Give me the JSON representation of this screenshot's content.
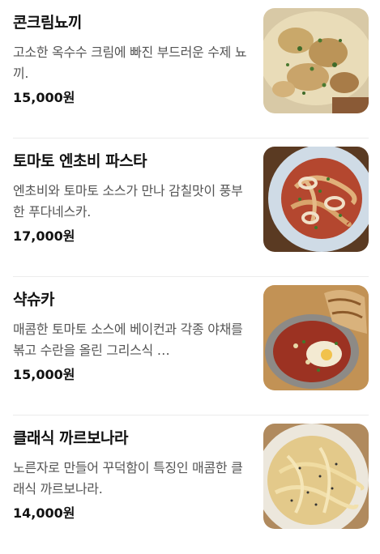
{
  "menu": [
    {
      "name": "콘크림뇨끼",
      "description": "고소한 옥수수 크림에 빠진 부드러운 수제 뇨끼.",
      "price": "15,000원",
      "image": "cream-gnocchi-photo"
    },
    {
      "name": "토마토 엔초비 파스타",
      "description": "엔초비와 토마토 소스가 만나 감칠맛이 풍부한 푸다네스카.",
      "price": "17,000원",
      "image": "tomato-anchovy-pasta-photo"
    },
    {
      "name": "샥슈카",
      "description": "매콤한 토마토 소스에 베이컨과 각종 야채를 볶고 수란을 올린 그리스식 …",
      "price": "15,000원",
      "image": "shakshuka-photo"
    },
    {
      "name": "클래식 까르보나라",
      "description": "노른자로 만들어 꾸덕함이 특징인 매콤한 클래식 까르보나라.",
      "price": "14,000원",
      "image": "carbonara-photo"
    }
  ]
}
